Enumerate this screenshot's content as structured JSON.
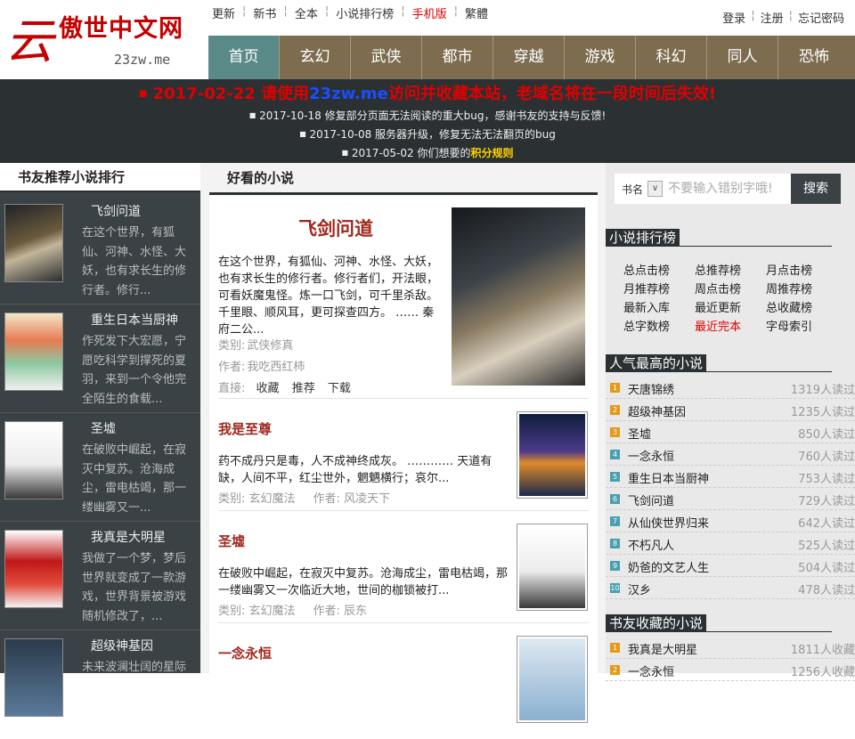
{
  "logo": {
    "glyph": "云",
    "name": "傲世中文网",
    "url": "23zw.me"
  },
  "top_links": [
    "更新",
    "新书",
    "全本",
    "小说排行榜",
    "手机版",
    "繁體"
  ],
  "user_links": [
    "登录",
    "注册",
    "忘记密码"
  ],
  "nav": [
    "首页",
    "玄幻",
    "武侠",
    "都市",
    "穿越",
    "游戏",
    "科幻",
    "同人",
    "恐怖"
  ],
  "notice": {
    "main_prefix": "2017-02-22 请使用",
    "main_link": "23zw.me",
    "main_suffix": "访问并收藏本站，老域名将在一段时间后失效!",
    "lines": [
      "2017-10-18 修复部分页面无法阅读的重大bug，感谢书友的支持与反馈!",
      "2017-10-08 服务器升级，修复无法无法翻页的bug",
      "2017-05-02 你们想要的"
    ],
    "rule_link": "积分规则"
  },
  "left": {
    "title": "书友推荐小说排行",
    "items": [
      {
        "name": "飞剑问道",
        "desc": "在这个世界，有狐仙、河神、水怪、大妖，也有求长生的修行者。修行..."
      },
      {
        "name": "重生日本当厨神",
        "desc": "作死发下大宏愿，宁愿吃科学到撑死的夏羽，来到一个令他完全陌生的食载..."
      },
      {
        "name": "圣墟",
        "desc": "在破败中崛起，在寂灭中复苏。沧海成尘，雷电枯竭，那一缕幽雾又一..."
      },
      {
        "name": "我真是大明星",
        "desc": "我做了一个梦，梦后世界就变成了一款游戏，世界背景被游戏随机修改了，..."
      },
      {
        "name": "超级神基因",
        "desc": "未来波澜壮阔的星际"
      }
    ]
  },
  "center": {
    "title": "好看的小说",
    "featured": {
      "title": "飞剑问道",
      "desc": "在这个世界，有狐仙、河神、水怪、大妖，也有求长生的修行者。修行者们，开法眼，可看妖魔鬼怪。炼一口飞剑，可千里杀敌。千里眼、顺风耳，更可探查四方。 …… 秦府二公...",
      "cat_label": "类别:",
      "category": "武侠修真",
      "author_label": "作者:",
      "author": "我吃西红柿",
      "direct_label": "直接:",
      "actions": [
        "收藏",
        "推荐",
        "下载"
      ]
    },
    "books": [
      {
        "title": "我是至尊",
        "desc": "药不成丹只是毒，人不成神终成灰。 ………… 天道有缺，人间不平，红尘世外，魍魉横行；哀尔...",
        "category": "玄幻魔法",
        "author": "风凌天下"
      },
      {
        "title": "圣墟",
        "desc": "在破败中崛起，在寂灭中复苏。沧海成尘，雷电枯竭，那一缕幽雾又一次临近大地，世间的枷锁被打...",
        "category": "玄幻魔法",
        "author": "辰东"
      },
      {
        "title": "一念永恒"
      }
    ]
  },
  "right": {
    "search": {
      "label": "书名",
      "placeholder": "不要输入错别字哦!",
      "button": "搜索"
    },
    "rank_title": "小说排行榜",
    "rank_links": [
      "总点击榜",
      "总推荐榜",
      "月点击榜",
      "月推荐榜",
      "周点击榜",
      "周推荐榜",
      "最新入库",
      "最近更新",
      "总收藏榜",
      "总字数榜",
      "最近完本",
      "字母索引"
    ],
    "popular_title": "人气最高的小说",
    "popular": [
      {
        "num": "1",
        "name": "天唐锦绣",
        "count": "1319人读过"
      },
      {
        "num": "2",
        "name": "超级神基因",
        "count": "1235人读过"
      },
      {
        "num": "3",
        "name": "圣墟",
        "count": "850人读过"
      },
      {
        "num": "4",
        "name": "一念永恒",
        "count": "760人读过"
      },
      {
        "num": "5",
        "name": "重生日本当厨神",
        "count": "753人读过"
      },
      {
        "num": "6",
        "name": "飞剑问道",
        "count": "729人读过"
      },
      {
        "num": "7",
        "name": "从仙侠世界归来",
        "count": "642人读过"
      },
      {
        "num": "8",
        "name": "不朽凡人",
        "count": "525人读过"
      },
      {
        "num": "9",
        "name": "奶爸的文艺人生",
        "count": "504人读过"
      },
      {
        "num": "10",
        "name": "汉乡",
        "count": "478人读过"
      }
    ],
    "fav_title": "书友收藏的小说",
    "favorites": [
      {
        "num": "1",
        "name": "我真是大明星",
        "count": "1811人收藏"
      },
      {
        "num": "2",
        "name": "一念永恒",
        "count": "1256人收藏"
      }
    ]
  },
  "colors": {
    "nav_bg": "#7d6c4e",
    "nav_active": "#5a8a87",
    "dark": "#2b3033",
    "title_red": "#a0281e",
    "notice_red": "#e00000",
    "link_blue": "#1a4eff",
    "rank_orange": "#e59a17",
    "rank_teal": "#4a9fae"
  }
}
